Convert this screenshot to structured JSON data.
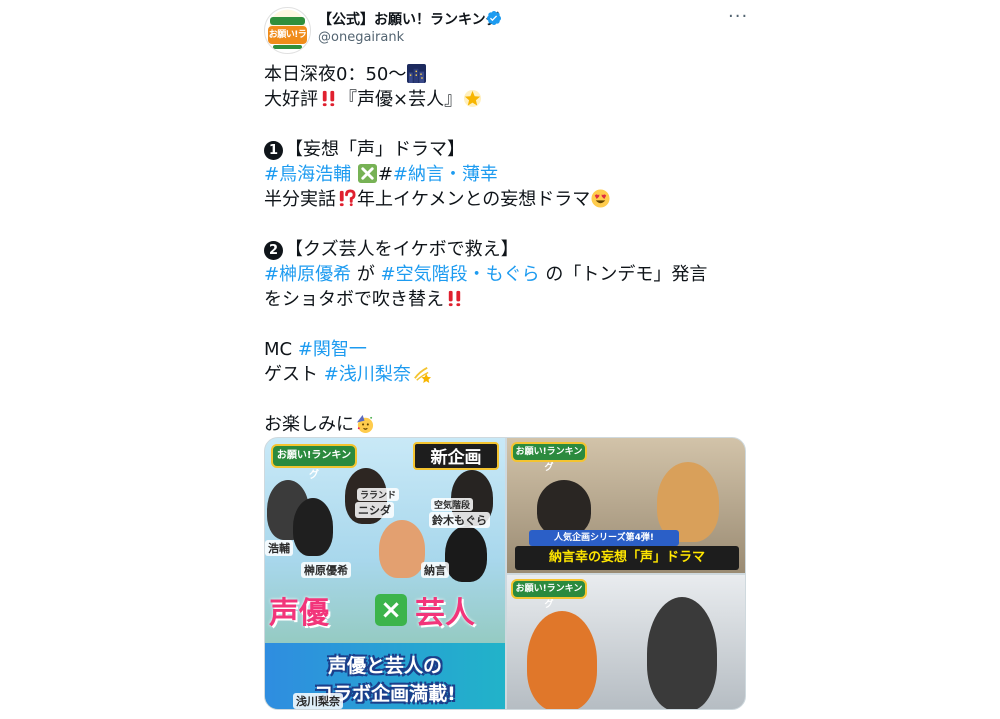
{
  "tweet": {
    "display_name": "【公式】お願い！ランキング",
    "handle": "@onegairank",
    "more_label": "···",
    "avatar_text": "お願い!ランキング"
  },
  "body": {
    "l1": "本日深夜0：50〜",
    "l2a": "大好評",
    "l2b": "『声優×芸人』",
    "l4": "【妄想「声」ドラマ】",
    "l5_tag1": "#鳥海浩輔",
    "l5_mid": "#",
    "l5_tag2": "#納言・薄幸",
    "l6a": "半分実話",
    "l6b": "年上イケメンとの妄想ドラマ",
    "l8": "【クズ芸人をイケボで救え】",
    "l9_tag1": "#榊原優希",
    "l9_mid1": " が ",
    "l9_tag2": "#空気階段・もぐら",
    "l9_tail": " の「トンデモ」発言",
    "l10": "をショタボで吹き替え",
    "l12a": "MC ",
    "l12_tag": "#関智一",
    "l13a": "ゲスト ",
    "l13_tag": "#浅川梨奈",
    "l15": "お楽しみに"
  },
  "media": {
    "logo_text": "お願い!ランキング",
    "new_plan": "新企画",
    "name_niza": "ニシダ",
    "name_niza_group": "ラランド",
    "name_mogura": "鈴木もぐら",
    "name_mogura_group": "空気階段",
    "name_toriumi": "浩輔",
    "name_sakakibara": "榊原優希",
    "name_nagon": "納言",
    "name_asakawa": "浅川梨奈",
    "seiyuu": "声優",
    "geinin": "芸人",
    "banner1": "声優と芸人の",
    "banner2": "コラボ企画満載!",
    "series_caption": "人気企画シリーズ第4弾!",
    "drama_caption": "納言幸の妄想「声」ドラマ"
  },
  "colors": {
    "hashtag": "#1d9bf0",
    "text": "#0f1419",
    "secondary": "#536471",
    "verified": "#1d9bf0"
  }
}
